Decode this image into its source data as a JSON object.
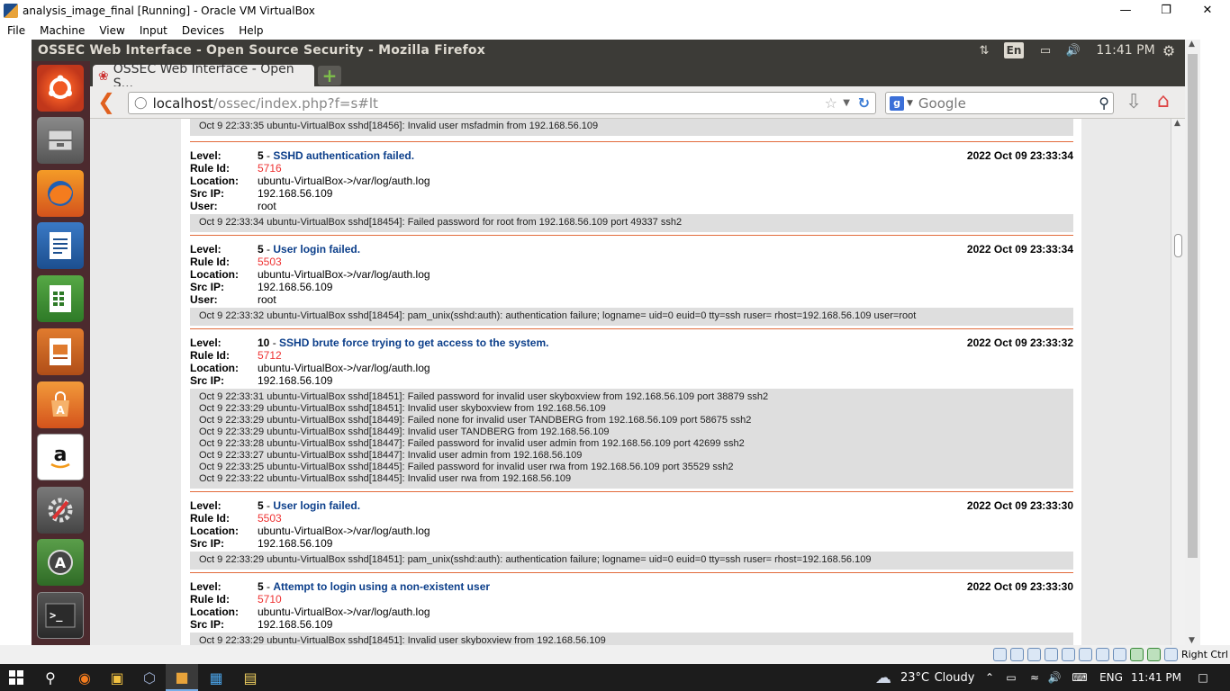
{
  "vbox": {
    "window_title": "analysis_image_final [Running] - Oracle VM VirtualBox",
    "menu": [
      "File",
      "Machine",
      "View",
      "Input",
      "Devices",
      "Help"
    ],
    "status_host_key": "Right Ctrl"
  },
  "ubuntu": {
    "window_title": "OSSEC Web Interface - Open Source Security - Mozilla Firefox",
    "keyboard": "En",
    "clock": "11:41 PM"
  },
  "firefox": {
    "tab_title": "OSSEC Web Interface - Open S...",
    "new_tab_label": "+",
    "url_host": "localhost",
    "url_path": "/ossec/index.php?f=s#lt",
    "search_placeholder": "Google"
  },
  "labels": {
    "level": "Level:",
    "rule_id": "Rule Id:",
    "location": "Location:",
    "src_ip": "Src IP:",
    "user": "User:"
  },
  "top_log": "Oct 9 22:33:35 ubuntu-VirtualBox sshd[18456]: Invalid user msfadmin from 192.168.56.109",
  "alerts": [
    {
      "level": "5",
      "description": "SSHD authentication failed.",
      "timestamp": "2022 Oct 09 23:33:34",
      "rule_id": "5716",
      "location": "ubuntu-VirtualBox->/var/log/auth.log",
      "src_ip": "192.168.56.109",
      "user": "root",
      "logs": [
        "Oct 9 22:33:34 ubuntu-VirtualBox sshd[18454]: Failed password for root from 192.168.56.109 port 49337 ssh2"
      ]
    },
    {
      "level": "5",
      "description": "User login failed.",
      "timestamp": "2022 Oct 09 23:33:34",
      "rule_id": "5503",
      "location": "ubuntu-VirtualBox->/var/log/auth.log",
      "src_ip": "192.168.56.109",
      "user": "root",
      "logs": [
        "Oct 9 22:33:32 ubuntu-VirtualBox sshd[18454]: pam_unix(sshd:auth): authentication failure; logname= uid=0 euid=0 tty=ssh ruser= rhost=192.168.56.109 user=root"
      ]
    },
    {
      "level": "10",
      "description": "SSHD brute force trying to get access to the system.",
      "timestamp": "2022 Oct 09 23:33:32",
      "rule_id": "5712",
      "location": "ubuntu-VirtualBox->/var/log/auth.log",
      "src_ip": "192.168.56.109",
      "logs": [
        "Oct 9 22:33:31 ubuntu-VirtualBox sshd[18451]: Failed password for invalid user skyboxview from 192.168.56.109 port 38879 ssh2",
        "Oct 9 22:33:29 ubuntu-VirtualBox sshd[18451]: Invalid user skyboxview from 192.168.56.109",
        "Oct 9 22:33:29 ubuntu-VirtualBox sshd[18449]: Failed none for invalid user TANDBERG from 192.168.56.109 port 58675 ssh2",
        "Oct 9 22:33:29 ubuntu-VirtualBox sshd[18449]: Invalid user TANDBERG from 192.168.56.109",
        "Oct 9 22:33:28 ubuntu-VirtualBox sshd[18447]: Failed password for invalid user admin from 192.168.56.109 port 42699 ssh2",
        "Oct 9 22:33:27 ubuntu-VirtualBox sshd[18447]: Invalid user admin from 192.168.56.109",
        "Oct 9 22:33:25 ubuntu-VirtualBox sshd[18445]: Failed password for invalid user rwa from 192.168.56.109 port 35529 ssh2",
        "Oct 9 22:33:22 ubuntu-VirtualBox sshd[18445]: Invalid user rwa from 192.168.56.109"
      ]
    },
    {
      "level": "5",
      "description": "User login failed.",
      "timestamp": "2022 Oct 09 23:33:30",
      "rule_id": "5503",
      "location": "ubuntu-VirtualBox->/var/log/auth.log",
      "src_ip": "192.168.56.109",
      "logs": [
        "Oct 9 22:33:29 ubuntu-VirtualBox sshd[18451]: pam_unix(sshd:auth): authentication failure; logname= uid=0 euid=0 tty=ssh ruser= rhost=192.168.56.109"
      ]
    },
    {
      "level": "5",
      "description": "Attempt to login using a non-existent user",
      "timestamp": "2022 Oct 09 23:33:30",
      "rule_id": "5710",
      "location": "ubuntu-VirtualBox->/var/log/auth.log",
      "src_ip": "192.168.56.109",
      "logs": [
        "Oct 9 22:33:29 ubuntu-VirtualBox sshd[18451]: Invalid user skyboxview from 192.168.56.109"
      ]
    }
  ],
  "windows_taskbar": {
    "weather_temp": "23°C",
    "weather_text": "Cloudy",
    "language": "ENG",
    "time": "11:41 PM"
  }
}
